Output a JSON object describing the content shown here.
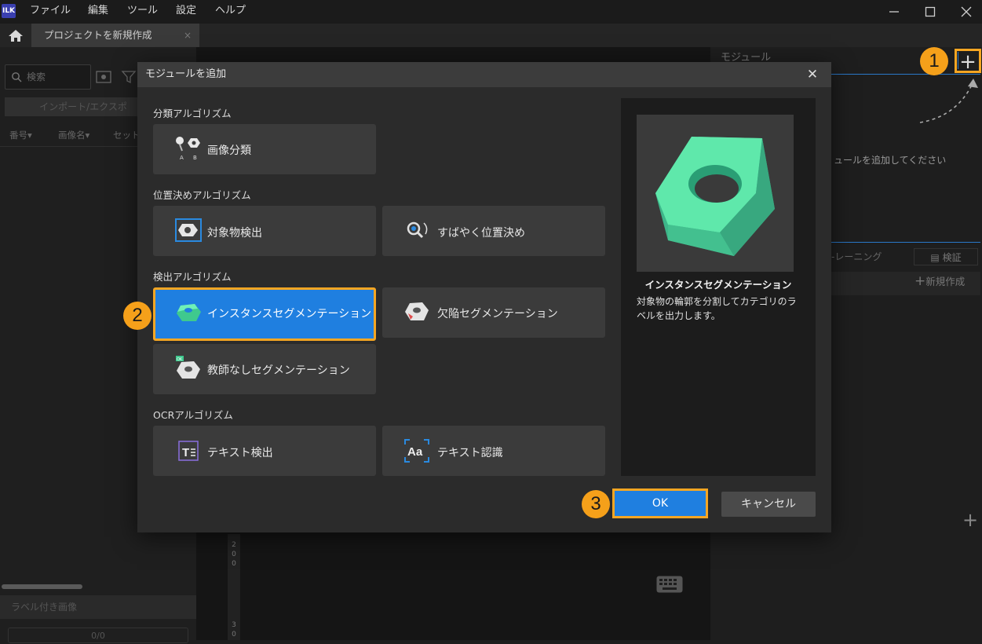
{
  "titlebar": {
    "logo": "ILK",
    "menu": [
      "ファイル",
      "編集",
      "ツール",
      "設定",
      "ヘルプ"
    ],
    "window_controls": [
      "minimize-icon",
      "maximize-icon",
      "close-icon"
    ]
  },
  "tab": {
    "label": "プロジェクトを新規作成",
    "close": "×"
  },
  "left_panel": {
    "search_placeholder": "検索",
    "import_export": "インポート/エクスポ",
    "columns": [
      "番号▾",
      "画像名▾",
      "セット"
    ],
    "labeled_images": "ラベル付き画像",
    "count": "0/0"
  },
  "right_panel": {
    "title": "モジュール",
    "add_button": "+",
    "hint": "ュールを追加してください",
    "training_tab": "-レーニング",
    "verify_tab": "検証",
    "new_create": "新規作成",
    "bottom_add": "+"
  },
  "canvas": {
    "ruler_top": "2\n0\n0",
    "ruler_bottom": "3\n0"
  },
  "callouts": {
    "one": "1",
    "two": "2",
    "three": "3"
  },
  "dialog": {
    "title": "モジュールを追加",
    "close": "✕",
    "sections": {
      "classification": "分類アルゴリズム",
      "positioning": "位置決めアルゴリズム",
      "inspection": "検出アルゴリズム",
      "ocr": "OCRアルゴリズム"
    },
    "modules": {
      "image_classification": "画像分類",
      "object_detection": "対象物検出",
      "fast_positioning": "すばやく位置決め",
      "instance_segmentation": "インスタンスセグメンテーション",
      "defect_segmentation": "欠陥セグメンテーション",
      "unsupervised_segmentation": "教師なしセグメンテーション",
      "text_detection": "テキスト検出",
      "text_recognition": "テキスト認識"
    },
    "selected_module": "instance_segmentation",
    "preview": {
      "title": "インスタンスセグメンテーション",
      "description": "対象物の輪郭を分割してカテゴリのラベルを出力します。"
    },
    "ok": "OK",
    "cancel": "キャンセル"
  },
  "colors": {
    "accent_blue": "#1f7fe0",
    "highlight_orange": "#f5a623",
    "nut_green": "#4de0a0"
  }
}
